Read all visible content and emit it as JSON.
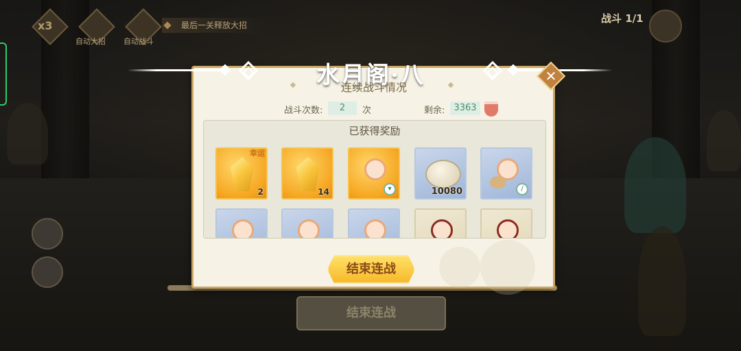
{
  "hud": {
    "speed": "x3",
    "auto_skill_label": "自动大招",
    "auto_battle_label": "自动战斗",
    "tip": "最后一关释放大招",
    "battle_label": "战斗",
    "battle_progress": "1/1"
  },
  "background": {
    "end_button_label": "结束连战"
  },
  "dialog": {
    "title": "水月阁·八",
    "subtitle": "连续战斗情况",
    "battle_count_label": "战斗次数:",
    "battle_count_value": "2",
    "battle_count_unit": "次",
    "remaining_label": "剩余:",
    "remaining_value": "3363",
    "rewards_title": "已获得奖励",
    "rewards": [
      {
        "kind": "gold-gem",
        "count": "2",
        "tag": "幸运"
      },
      {
        "kind": "gold-gem",
        "count": "14"
      },
      {
        "kind": "character",
        "badge": "bowl-icon"
      },
      {
        "kind": "shell",
        "count": "10080"
      },
      {
        "kind": "character-spoon",
        "badge": "spoon-icon"
      },
      {
        "kind": "character"
      },
      {
        "kind": "character"
      },
      {
        "kind": "character"
      },
      {
        "kind": "character-dark"
      },
      {
        "kind": "character-dark"
      }
    ],
    "end_button_label": "结束连战",
    "close_icon": "close-icon"
  },
  "colors": {
    "accent_gold": "#f7b92a",
    "frame_gold": "#c8a664",
    "panel_bg": "#f6f3e6",
    "value_green": "#4e8c6b"
  }
}
